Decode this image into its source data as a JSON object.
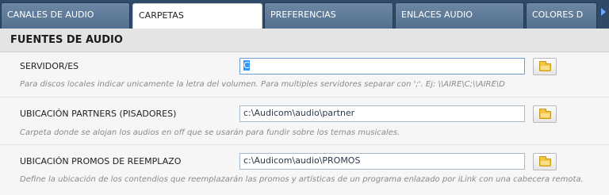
{
  "tabs": [
    {
      "label": "CANALES DE AUDIO"
    },
    {
      "label": "CARPETAS"
    },
    {
      "label": "PREFERENCIAS"
    },
    {
      "label": "ENLACES AUDIO"
    },
    {
      "label": "COLORES D"
    }
  ],
  "section": {
    "title": "FUENTES DE AUDIO"
  },
  "fields": [
    {
      "label": "SERVIDOR/ES",
      "value": "C",
      "help": "Para discos locales indicar unicamente la letra del volumen. Para multiples servidores separar con ';'. Ej: \\\\AIRE\\C;\\\\AIRE\\D"
    },
    {
      "label": "UBICACIÓN PARTNERS (PISADORES)",
      "value": "c:\\Audicom\\audio\\partner",
      "help": "Carpeta donde se alojan los audios en off que se usarán para fundir sobre los temas musicales."
    },
    {
      "label": "UBICACIÓN PROMOS DE REEMPLAZO",
      "value": "c:\\Audicom\\audio\\PROMOS",
      "help": "Define la ubicación de los contendios que reemplazarán las promos y artísticas de un programa enlazado por iLink con una cabecera remota."
    }
  ],
  "icons": {
    "browse": "folder-icon",
    "scroll_tabs": "chevron-right-icon"
  }
}
